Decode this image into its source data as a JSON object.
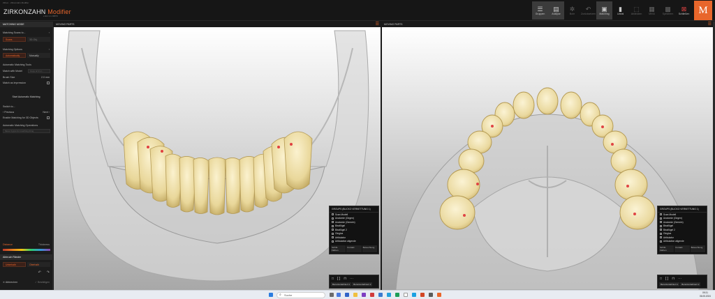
{
  "window": {
    "title_hint": "Zirkon · Zirkonzahn Modifier"
  },
  "brand": {
    "name": "ZIRKONZAHN",
    "accent": "Modifier",
    "version": "v.24.1.1.9879"
  },
  "toolbar_left": [
    {
      "label": "Gruppen",
      "icon": "menu-icon",
      "glyph": "☰",
      "active": true
    },
    {
      "label": "Analyse",
      "icon": "analyse-icon",
      "glyph": "▤",
      "active": true
    },
    {
      "label": "Bohr",
      "icon": "drill-icon",
      "glyph": "✲",
      "dim": true
    },
    {
      "label": "Zurücksetzen",
      "icon": "undo-icon",
      "glyph": "↶",
      "dim": true
    },
    {
      "label": "Matching",
      "icon": "matching-icon",
      "glyph": "▣",
      "active": true
    },
    {
      "label": "Lineal",
      "icon": "ruler-icon",
      "glyph": "▮"
    },
    {
      "label": "Abdecken",
      "icon": "cover-icon",
      "glyph": "⬚",
      "dim": true
    }
  ],
  "toolbar_right": [
    {
      "label": "Menü",
      "icon": "grid-icon",
      "glyph": "▦",
      "dim": true
    },
    {
      "label": "Speichern",
      "icon": "save-icon",
      "glyph": "▩",
      "dim": true
    },
    {
      "label": "Schließen",
      "icon": "close-icon",
      "glyph": "⊠",
      "red": true
    }
  ],
  "logo": "M",
  "left_panel": {
    "header": "MATCHING MODE",
    "matching_source_label": "Matching Scans to...",
    "source_options": [
      "Scans",
      "3D-Obj."
    ],
    "matching_options_label": "Matching Options",
    "mode_options": [
      "Automatically",
      "Manually"
    ],
    "settings_label": "Automatic Matching Tools",
    "match_with_model": "Match with Model",
    "match_with_model_value": "Copy of O U...",
    "brush_size_label": "Brush Size",
    "brush_size_value": "2.0 mm",
    "match_as_impression": "Match as impression",
    "start_button": "Start Automatic Matching",
    "switch_label": "Switch to...",
    "previous": "Previous",
    "next": "Next",
    "enable_3d": "Enable Matching for 3D Objects",
    "automatic_matching_opts": "Automatic Matching Operations",
    "auto_placeholder": "Move 3 grps for matching thing",
    "distance_tabs": [
      "Distance",
      "Thickness"
    ],
    "section2": "Abbruch Ränder",
    "sub_buttons": [
      "Unterhalb",
      "Oberhalb"
    ],
    "bottom_buttons": [
      "Abbrechen",
      "Bestätigen"
    ]
  },
  "viewports": [
    {
      "title": "MOVING PARTS",
      "groups_panel": {
        "title": "GROUPS (BLICKO VERKETTUNG 1)",
        "items": [
          "Scan Modell",
          "Anatomie (Gegen)",
          "Anatomie (Gemein)",
          "Bissflügel",
          "Bissflügel 2",
          "Gingiva",
          "Artikulator",
          "Artikulation aligende"
        ],
        "buttons": [
          "Sichtb. Färben",
          "Kontakt",
          "Beleuchtung"
        ]
      },
      "bottom_tabs": [
        "Benutzerdefiniert 1",
        "Benutzerdefiniert 2"
      ]
    },
    {
      "title": "MOVING PARTS",
      "groups_panel": {
        "title": "GROUPS (BLICKO VERKETTUNG 1)",
        "items": [
          "Scan Modell",
          "Anatomie (Gegen)",
          "Anatomie (Gemein)",
          "Bissflügel",
          "Bissflügel 2",
          "Gingiva",
          "Artikulator",
          "Artikulation aligende"
        ],
        "buttons": [
          "Sichtb. Färben",
          "Kontakt",
          "Beleuchtung"
        ]
      },
      "bottom_tabs": [
        "Benutzerdefiniert 1",
        "Benutzerdefiniert 2"
      ]
    }
  ],
  "taskbar": {
    "search_placeholder": "Suche",
    "time": "09:31",
    "date": "06.05.2024"
  },
  "colors": {
    "accent": "#e8662b",
    "tooth": "#efe0a8",
    "bone": "#d6d6d6"
  }
}
